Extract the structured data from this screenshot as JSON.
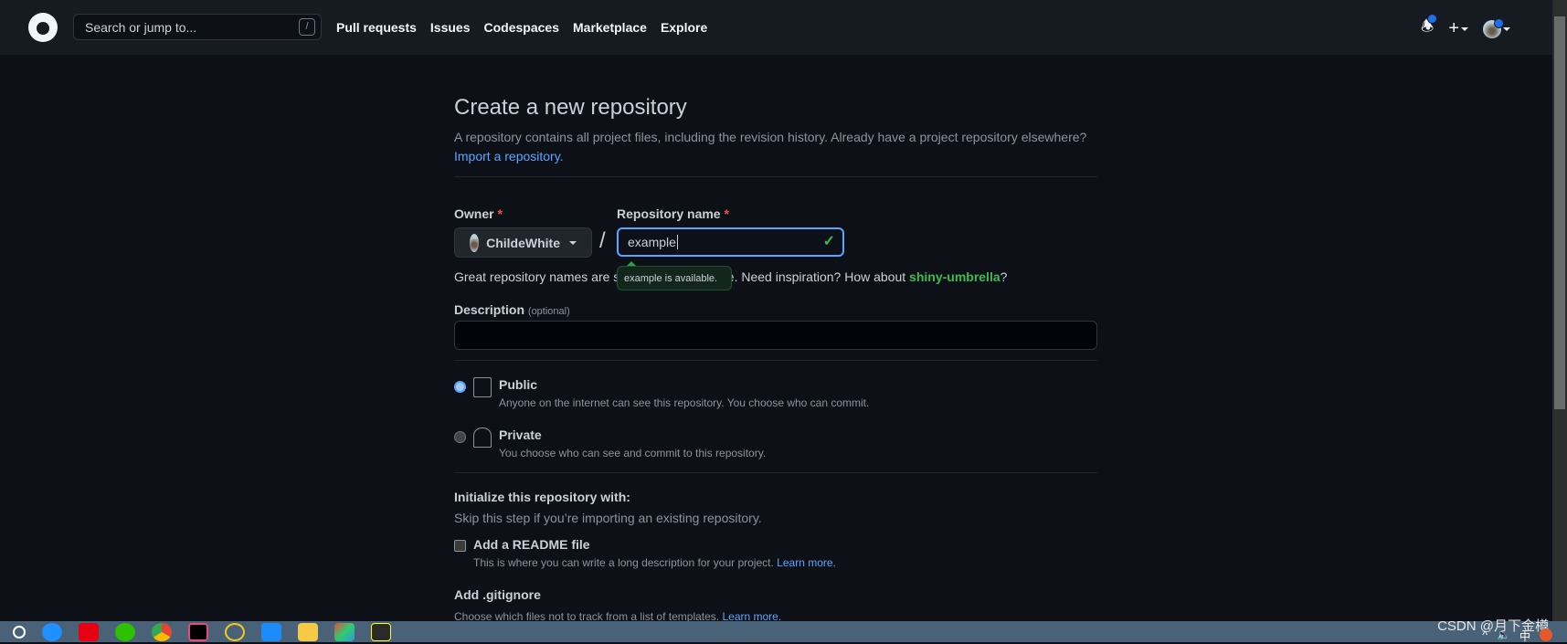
{
  "header": {
    "search_placeholder": "Search or jump to...",
    "search_shortcut": "/",
    "nav": [
      "Pull requests",
      "Issues",
      "Codespaces",
      "Marketplace",
      "Explore"
    ],
    "icons": [
      "bell-icon",
      "plus-icon",
      "avatar"
    ]
  },
  "page": {
    "title": "Create a new repository",
    "subtitle": "A repository contains all project files, including the revision history. Already have a project repository elsewhere?",
    "import_link": "Import a repository."
  },
  "form": {
    "owner_label": "Owner",
    "required_mark": "*",
    "owner_value": "ChildeWhite",
    "separator": "/",
    "repo_label": "Repository name",
    "repo_value": "example",
    "tooltip": "example is available.",
    "hint_prefix": "Great repository names are short and memorable. Need inspiration? How about ",
    "hint_suggestion": "shiny-umbrella",
    "hint_suffix": "?",
    "description_label": "Description",
    "description_optional": "(optional)",
    "description_value": "",
    "visibility": [
      {
        "title": "Public",
        "desc": "Anyone on the internet can see this repository. You choose who can commit.",
        "selected": true
      },
      {
        "title": "Private",
        "desc": "You choose who can see and commit to this repository.",
        "selected": false
      }
    ],
    "init_title": "Initialize this repository with:",
    "init_sub": "Skip this step if you’re importing an existing repository.",
    "readme_label": "Add a README file",
    "readme_desc": "This is where you can write a long description for your project.",
    "learn_more": "Learn more.",
    "gitignore_title": "Add .gitignore",
    "gitignore_desc": "Choose which files not to track from a list of templates."
  },
  "taskbar": {
    "watermark": "CSDN @月下金樽",
    "tray": [
      "^",
      "中"
    ]
  },
  "colors": {
    "accent": "#58a6ff",
    "success": "#3fb950",
    "bg": "#0d1117",
    "header": "#161b22"
  }
}
